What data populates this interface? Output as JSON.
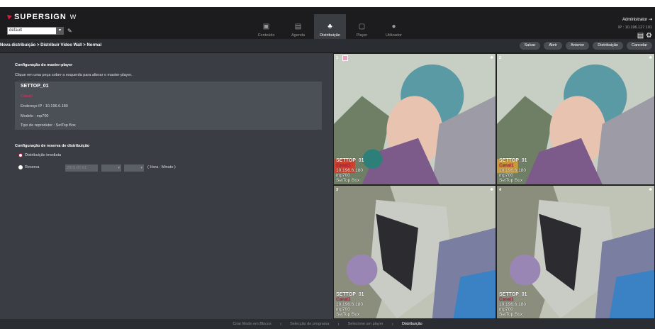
{
  "app": {
    "brand": "SUPERSIGN",
    "brand_suffix": "W",
    "group_value": "default"
  },
  "nav": [
    {
      "label": "Conteúdo",
      "icon": "content-icon"
    },
    {
      "label": "Agenda",
      "icon": "calendar-icon"
    },
    {
      "label": "Distribuição",
      "icon": "distribution-icon",
      "active": true
    },
    {
      "label": "Player",
      "icon": "player-icon"
    },
    {
      "label": "Utilizador",
      "icon": "user-icon"
    }
  ],
  "user": {
    "name": "Administrator",
    "ip": "IP : 10.196.127.101"
  },
  "breadcrumb": "Nova distribuição > Distribuir Vídeo Wall > Normal",
  "actions": [
    "Salvar",
    "Abrir",
    "Anterior",
    "Distribuição",
    "Cancelar"
  ],
  "master": {
    "title": "Configuração do master-player",
    "hint": "Clique em uma peça sobre a esquerda para alterar o master-player.",
    "name": "SETTOP_01",
    "channel": "Canal1",
    "ip": "Endereço IP : 10.196.6.180",
    "model": "Modelo : mp700",
    "type": "Tipo de reprodutor : SetTop Box"
  },
  "reservation": {
    "title": "Configuração de reserva de distribuição",
    "immediate": "Distribuição imediata",
    "reserve": "Reserva",
    "date": "2015-07-01",
    "time_hint": "( Hora : Minuto )"
  },
  "tiles": [
    {
      "num": "1",
      "name": "SETTOP_01",
      "channel": "Canal1",
      "ip": "10.196.6.180",
      "model": "mp700",
      "type": "SetTop Box"
    },
    {
      "num": "2",
      "name": "SETTOP_01",
      "channel": "Canal1",
      "ip": "10.196.6.180",
      "model": "mp700",
      "type": "SetTop Box"
    },
    {
      "num": "3",
      "name": "SETTOP_01",
      "channel": "Canal1",
      "ip": "10.196.6.180",
      "model": "mp700",
      "type": "SetTop Box"
    },
    {
      "num": "4",
      "name": "SETTOP_01",
      "channel": "Canal1",
      "ip": "10.196.6.180",
      "model": "mp700",
      "type": "SetTop Box"
    }
  ],
  "steps": [
    "Criar Modo em Blocos",
    "Selecção de programa",
    "Selecione um player",
    "Distribuição"
  ],
  "colors": {
    "accent": "#c01c3c",
    "header": "#1c1c1e",
    "panel": "#3a3e44"
  }
}
